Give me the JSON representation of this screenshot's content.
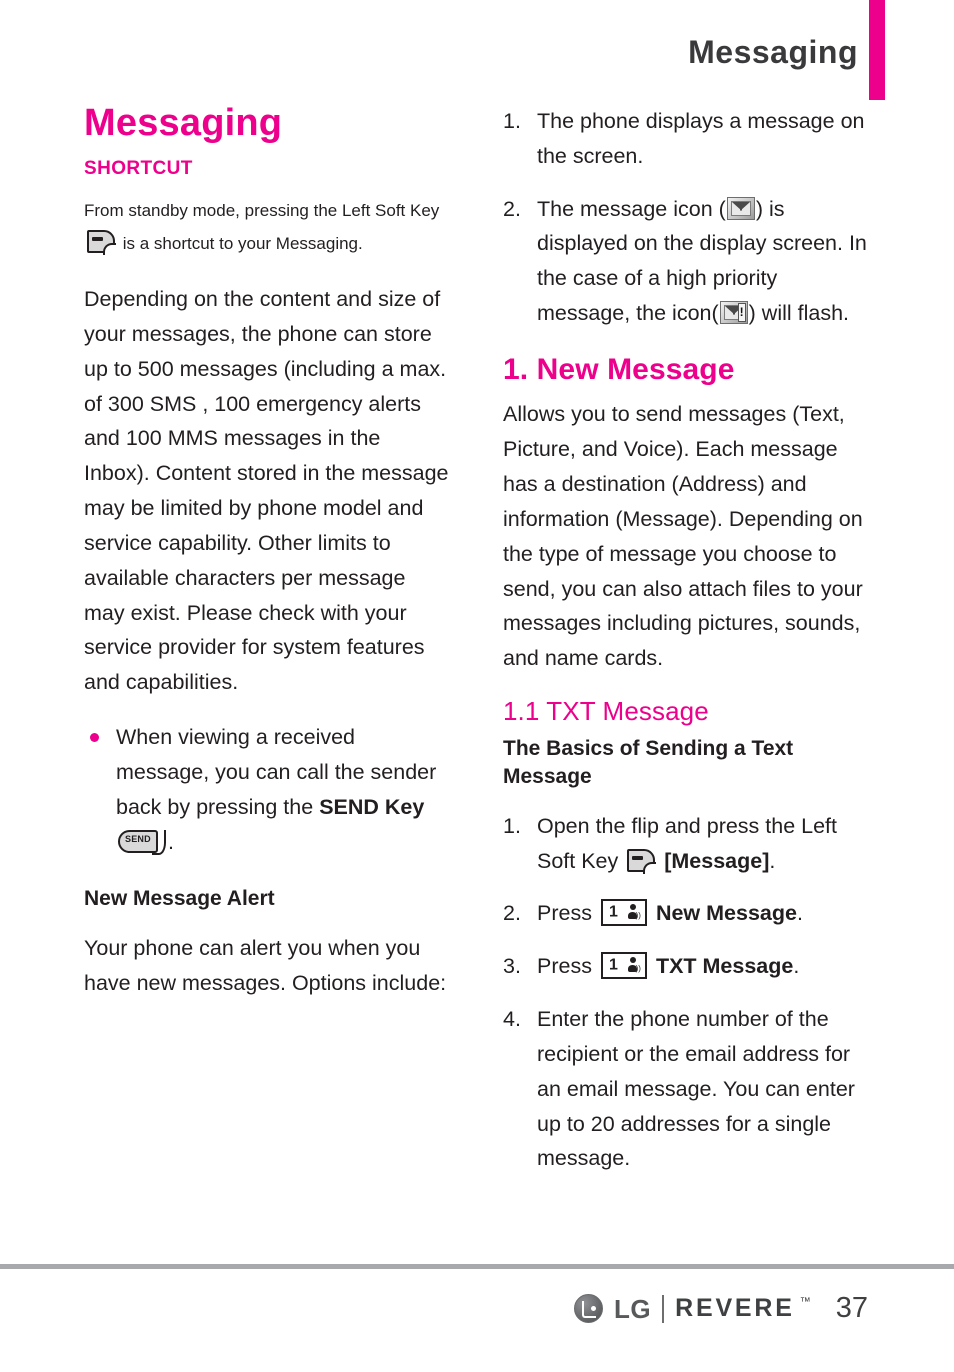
{
  "header": {
    "title": "Messaging",
    "accent_color": "#ec008c"
  },
  "left_column": {
    "doc_title": "Messaging",
    "shortcut_heading": "SHORTCUT",
    "shortcut_note_before": "From standby mode, pressing the Left Soft Key",
    "shortcut_note_after": "is a shortcut to your Messaging.",
    "paragraph_1": "Depending on the content and size of your messages, the phone can store up to 500 messages (including a max. of 300 SMS , 100 emergency alerts and 100 MMS  messages in the Inbox). Content stored in the message may be limited by phone model and service capability. Other limits to available characters per message may exist. Please check with your service provider for system features and capabilities.",
    "bullets": [
      {
        "text_before": "When viewing a received message, you can call the sender back by pressing the",
        "bold_label": "SEND Key",
        "icon": "send-key-icon",
        "text_after": "."
      }
    ],
    "alert_heading": "New Message Alert",
    "alert_paragraph": "Your phone can alert you when you have new messages. Options include:"
  },
  "right_column": {
    "intro_steps": [
      {
        "number": "1.",
        "text": "The phone displays a message on the screen."
      },
      {
        "number": "2.",
        "segments": [
          "The message icon (",
          ") is displayed on the display screen. In the case of a high priority message, the icon(",
          ") will flash."
        ],
        "icons": [
          "message-envelope-icon",
          "high-priority-envelope-icon"
        ]
      }
    ],
    "section_title": "1. New Message",
    "section_paragraph": "Allows you to send messages (Text, Picture, and Voice). Each message has a destination (Address) and information (Message). Depending on the type of message you choose to send, you can also attach files to your messages including pictures, sounds, and name cards.",
    "subsection_title": "1.1 TXT Message",
    "subsection_lead": "The Basics of Sending a Text Message",
    "steps": [
      {
        "number": "1.",
        "text_before": "Open the flip and press the Left Soft Key",
        "icon": "soft-key-icon",
        "bold_after": "[Message]",
        "text_end": "."
      },
      {
        "number": "2.",
        "text_before": "Press",
        "icon": "number-key-1-icon",
        "bold_after": "New Message",
        "text_end": "."
      },
      {
        "number": "3.",
        "text_before": "Press",
        "icon": "number-key-1-icon",
        "bold_after": "TXT Message",
        "text_end": "."
      },
      {
        "number": "4.",
        "text": "Enter the phone number of the recipient or the email address for an email message. You can enter up to 20 addresses for a single message."
      }
    ]
  },
  "footer": {
    "brand_lg": "LG",
    "brand_model": "REVERE",
    "trademark": "™",
    "page_number": "37"
  }
}
